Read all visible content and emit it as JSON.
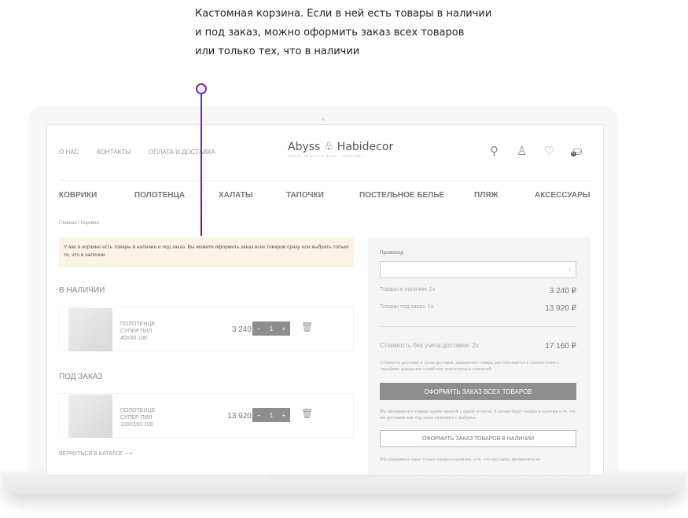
{
  "callout": [
    "Кастомная корзина. Если в ней есть товары в наличии",
    "и под заказ, можно оформить заказ всех товаров",
    "или только тех, что в наличии"
  ],
  "top_links": [
    "О НАС",
    "КОНТАКТЫ",
    "ОПЛАТА И ДОСТАВКА"
  ],
  "logo": {
    "name": "Abyss ♧ Habidecor",
    "tagline": "FINEST TOWELS & RUGS - PORTUGAL"
  },
  "cart_count": "0",
  "nav": [
    "КОВРИКИ",
    "ПОЛОТЕНЦА",
    "ХАЛАТЫ",
    "ТАПОЧКИ",
    "ПОСТЕЛЬНОЕ БЕЛЬЕ",
    "ПЛЯЖ",
    "АКСЕССУАРЫ"
  ],
  "breadcrumb": "Главная  /  Корзина",
  "alert": "У вас в корзине есть товары в наличии и под заказ. Вы можете оформить заказ всех товаров сразу или выбрать только те, что в наличии.",
  "sections": [
    {
      "title": "В НАЛИЧИИ",
      "item": {
        "name": [
          "ПОЛОТЕНЦЕ",
          "СУПЕР ПИЛ",
          "40Х60 100"
        ],
        "price": "3 240 ₽",
        "qty": "1"
      }
    },
    {
      "title": "ПОД ЗАКАЗ",
      "item": {
        "name": [
          "ПОЛОТЕНЦЕ",
          "СУПЕР ПИЛ",
          "100Х150 100"
        ],
        "price": "13 920 ₽",
        "qty": "1"
      }
    }
  ],
  "back_link": "ВЕРНУТЬСЯ В КАТАЛОГ ⟶",
  "summary": {
    "promo_label": "Промокод",
    "in_stock_label": "Товары в наличии: 1х",
    "in_stock_value": "3 240 ₽",
    "order_label": "Товары под заказ: 1х",
    "order_value": "13 920 ₽",
    "total_label": "Стоимость без учета доставки: 2х",
    "total_value": "17 160 ₽",
    "delivery_note": "Стоимость доставки и сроки доставки, заказанного товара рассчитывается в соответствии с тарифами курьерских служб или транспортных компаний",
    "btn_all": "ОФОРМИТЬ ЗАКАЗ ВСЕХ ТОВАРОВ",
    "all_note": "Мы оформим все товары одним заказом с одной оплатой. В заказе будут товары в наличии и те, что мы доставим вам под заказ напрямую с фабрики.",
    "btn_stock": "ОФОРМИТЬ ЗАКАЗ ТОВАРОВ В НАЛИЧИИ",
    "stock_note": "Мф оформим в заказ только товары в наличии, а те, что под заказ, автоматически"
  }
}
